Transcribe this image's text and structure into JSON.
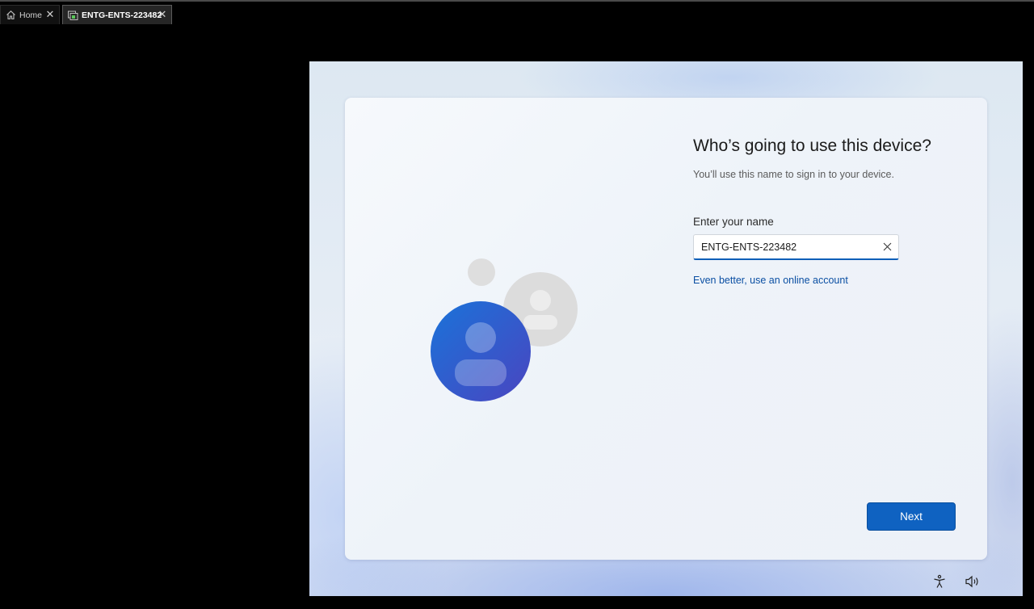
{
  "tabs": [
    {
      "label": "Home",
      "icon": "home-icon"
    },
    {
      "label": "ENTG-ENTS-223482",
      "icon": "vm-icon",
      "active": true
    }
  ],
  "setup": {
    "title": "Who’s going to use this device?",
    "subtitle": "You’ll use this name to sign in to your device.",
    "name_label": "Enter your name",
    "name_value": "ENTG-ENTS-223482",
    "online_link": "Even better, use an online account",
    "next_label": "Next"
  },
  "taskbar_icons": [
    "accessibility-icon",
    "volume-icon"
  ],
  "colors": {
    "accent": "#0f62c1",
    "link": "#0b4fa3",
    "avatar_primary": "#2f6bd6",
    "avatar_secondary": "#dcdcdc"
  }
}
